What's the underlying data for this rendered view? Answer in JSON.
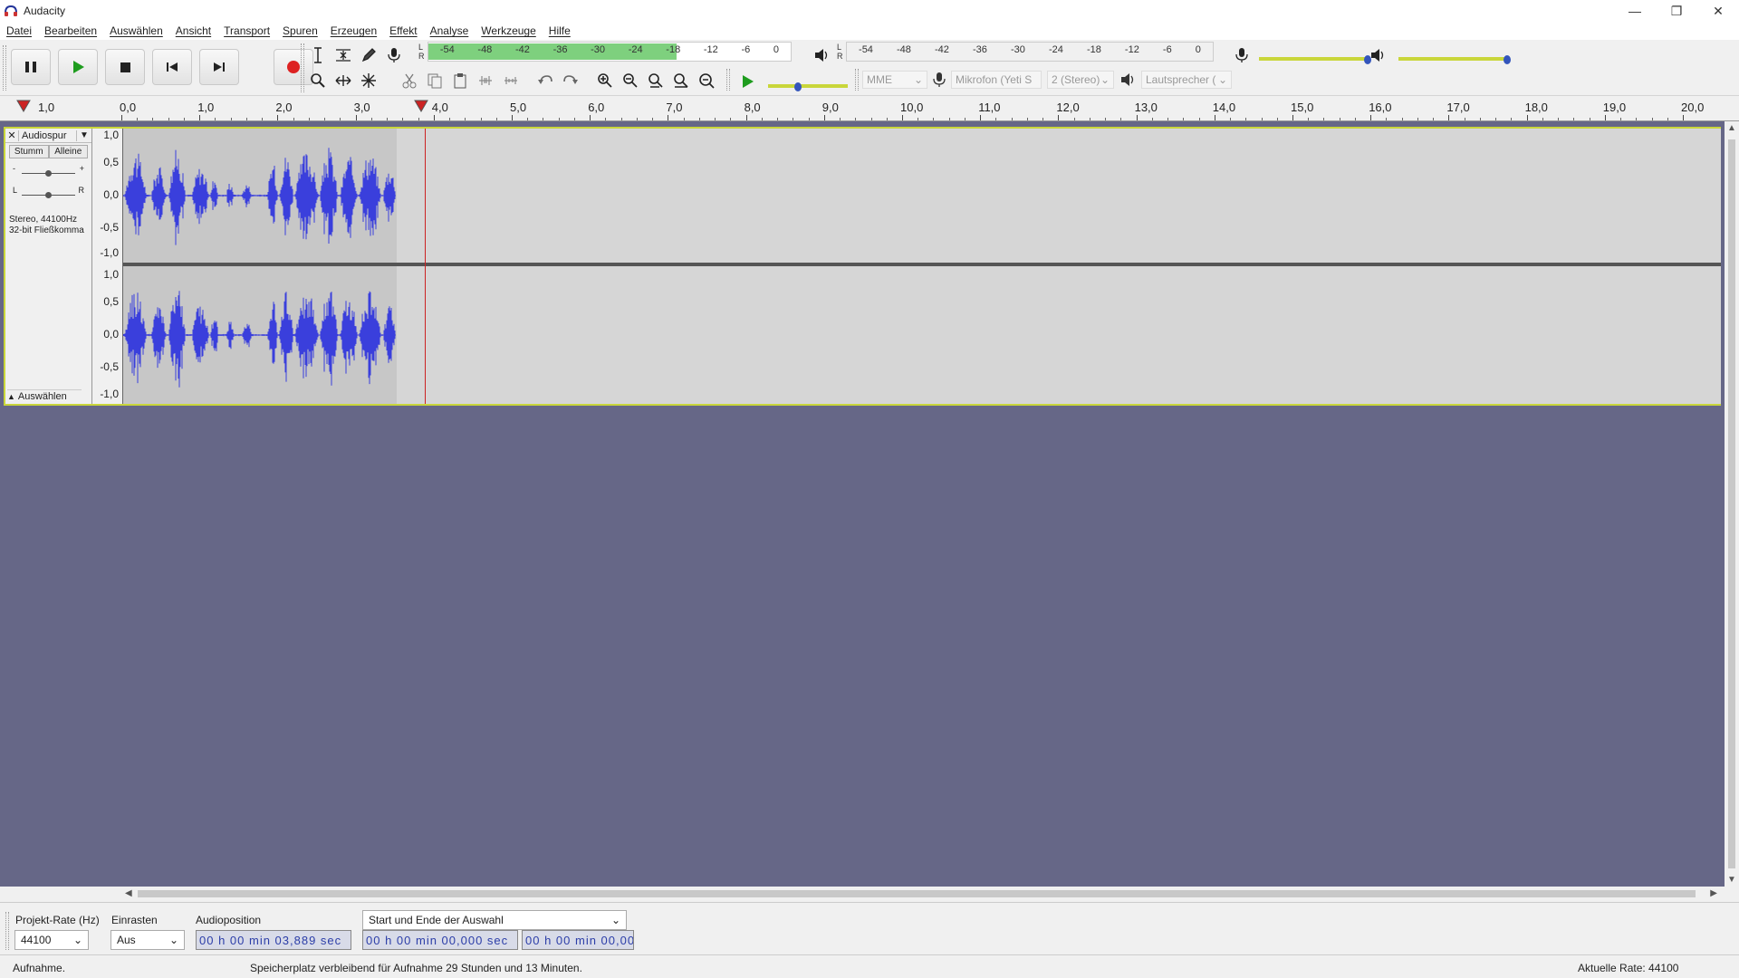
{
  "window": {
    "title": "Audacity",
    "controls": [
      "—",
      "❐",
      "✕"
    ]
  },
  "menu": [
    "Datei",
    "Bearbeiten",
    "Auswählen",
    "Ansicht",
    "Transport",
    "Spuren",
    "Erzeugen",
    "Effekt",
    "Analyse",
    "Werkzeuge",
    "Hilfe"
  ],
  "transport": {
    "buttons": [
      {
        "name": "pause-button",
        "icon": "pause-icon"
      },
      {
        "name": "play-button",
        "icon": "play-icon"
      },
      {
        "name": "stop-button",
        "icon": "stop-icon"
      },
      {
        "name": "skip-start-button",
        "icon": "skip-start-icon"
      },
      {
        "name": "skip-end-button",
        "icon": "skip-end-icon"
      },
      {
        "name": "record-button",
        "icon": "record-icon"
      }
    ]
  },
  "record_meter": {
    "l_label": "L",
    "r_label": "R",
    "ticks": [
      "-54",
      "-48",
      "-42",
      "-36",
      "-30",
      "-24",
      "-18",
      "-12",
      "-6",
      "0"
    ]
  },
  "playback_meter": {
    "l_label": "L",
    "r_label": "R",
    "ticks": [
      "-54",
      "-48",
      "-42",
      "-36",
      "-30",
      "-24",
      "-18",
      "-12",
      "-6",
      "0"
    ]
  },
  "devices": {
    "host": "MME",
    "input": "Mikrofon (Yeti S",
    "channels": "2 (Stereo)",
    "output": "Lautsprecher ("
  },
  "ruler": {
    "left_label": "1,0",
    "ticks": [
      "0,0",
      "1,0",
      "2,0",
      "3,0",
      "4,0",
      "5,0",
      "6,0",
      "7,0",
      "8,0",
      "9,0",
      "10,0",
      "11,0",
      "12,0",
      "13,0",
      "14,0",
      "15,0",
      "16,0",
      "17,0",
      "18,0",
      "19,0",
      "20,0"
    ]
  },
  "track": {
    "name": "Audiospur",
    "mute": "Stumm",
    "solo": "Alleine",
    "gain_minus": "-",
    "gain_plus": "+",
    "pan_left": "L",
    "pan_right": "R",
    "info_line1": "Stereo, 44100Hz",
    "info_line2": "32-bit Fließkomma",
    "select_label": "Auswählen",
    "scale_labels": [
      "1,0",
      "0,5",
      "0,0",
      "-0,5",
      "-1,0"
    ],
    "recorded_seconds": 3.5,
    "cursor_seconds": 3.889
  },
  "selection_bar": {
    "project_rate_label": "Projekt-Rate (Hz)",
    "project_rate_value": "44100",
    "snap_label": "Einrasten",
    "snap_value": "Aus",
    "audio_position_label": "Audioposition",
    "audio_position_value": "00 h 00 min 03,889 sec",
    "selection_mode": "Start und Ende der Auswahl",
    "selection_start": "00 h 00 min 00,000 sec",
    "selection_end": "00 h 00 min 00,00"
  },
  "status": {
    "state": "Aufnahme.",
    "disk_space": "Speicherplatz verbleibend für Aufnahme 29 Stunden und 13 Minuten.",
    "rate": "Aktuelle Rate: 44100"
  },
  "colors": {
    "waveform": "#3a3fdc",
    "track_bg": "#666787",
    "record_red": "#dd2222",
    "meter_green": "#7ed07e",
    "selected_border": "#c9d63a"
  }
}
